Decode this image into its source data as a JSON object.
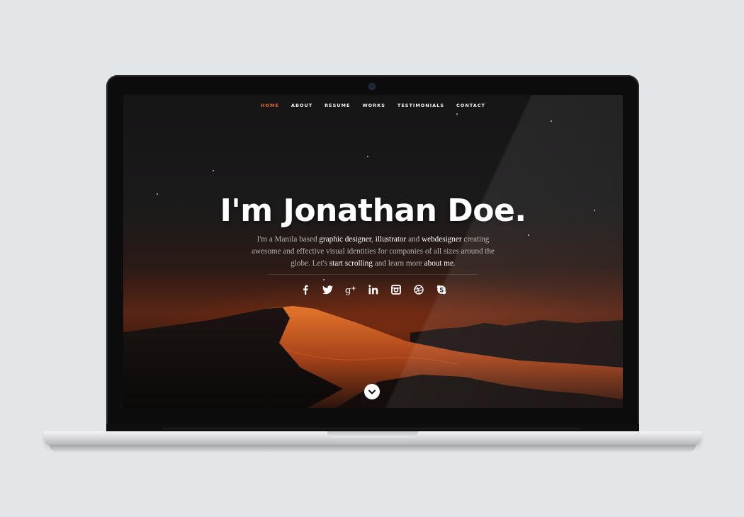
{
  "nav": {
    "items": [
      {
        "label": "HOME",
        "active": true
      },
      {
        "label": "ABOUT",
        "active": false
      },
      {
        "label": "RESUME",
        "active": false
      },
      {
        "label": "WORKS",
        "active": false
      },
      {
        "label": "TESTIMONIALS",
        "active": false
      },
      {
        "label": "CONTACT",
        "active": false
      }
    ],
    "active_color": "#e46a2a"
  },
  "hero": {
    "title": "I'm Jonathan Doe.",
    "intro_1": "I'm a Manila based ",
    "strong_1": "graphic designer",
    "sep_1": ", ",
    "strong_2": "illustrator",
    "sep_2": " and ",
    "strong_3": "webdesigner",
    "intro_2": " creating awesome and effective visual identities for companies of all sizes around the globe. Let's ",
    "strong_4": "start scrolling",
    "intro_3": " and learn more ",
    "strong_5": "about me",
    "intro_4": "."
  },
  "social": [
    {
      "icon": "facebook-icon"
    },
    {
      "icon": "twitter-icon"
    },
    {
      "icon": "google-plus-icon"
    },
    {
      "icon": "linkedin-icon"
    },
    {
      "icon": "instagram-icon"
    },
    {
      "icon": "dribbble-icon"
    },
    {
      "icon": "skype-icon"
    }
  ],
  "scroll_icon": "chevron-down-icon",
  "colors": {
    "accent": "#e46a2a",
    "page_background": "#e3e6e8"
  }
}
